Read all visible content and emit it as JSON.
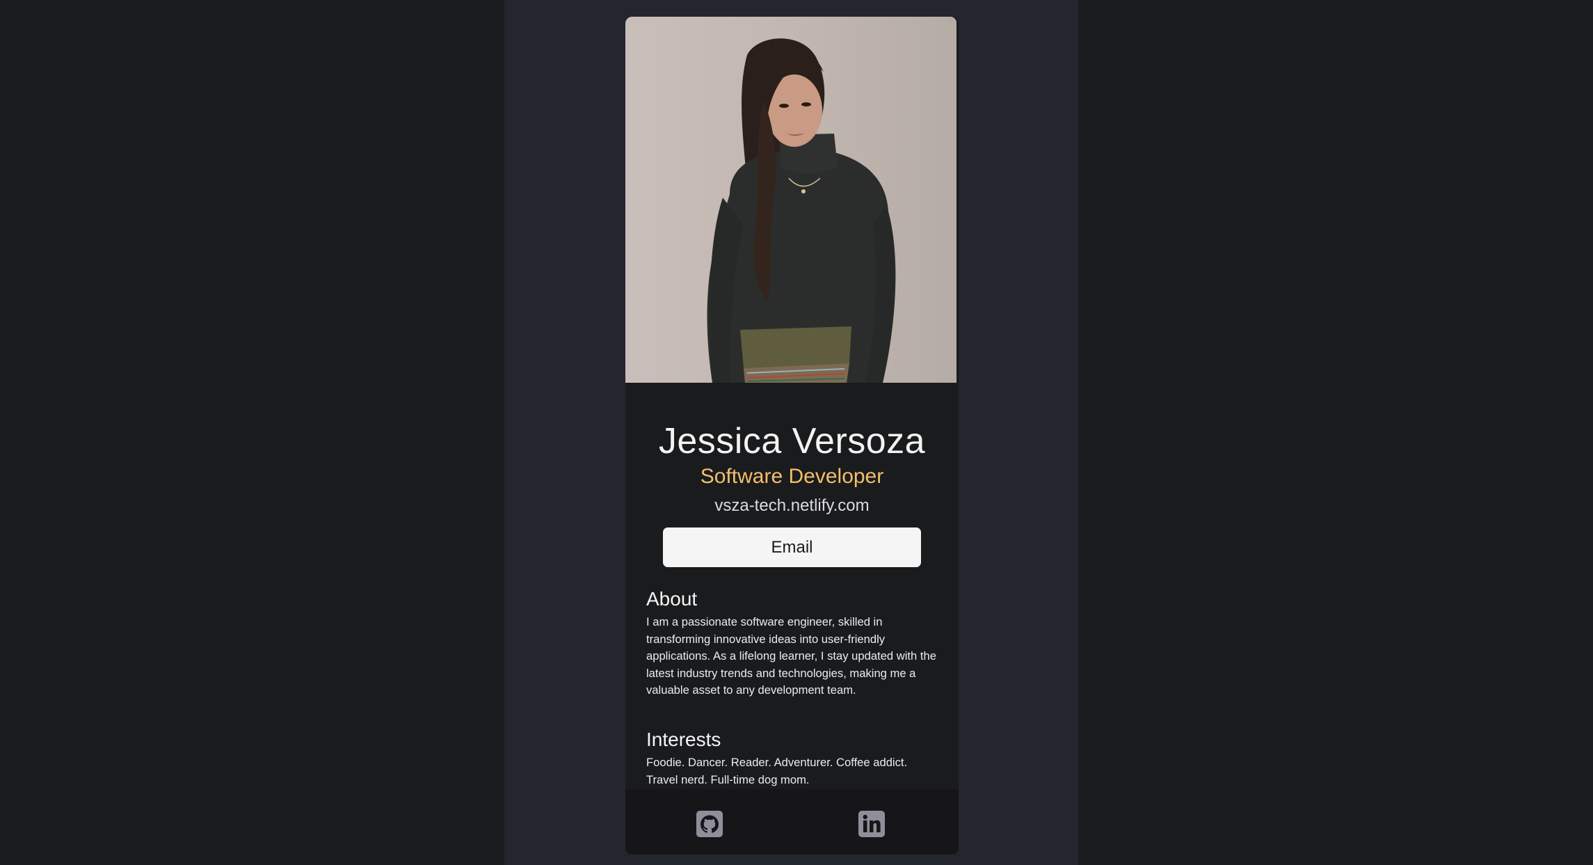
{
  "profile": {
    "photo_alt": "Portrait of Jessica Versoza",
    "name": "Jessica Versoza",
    "role": "Software Developer",
    "website": "vsza-tech.netlify.com",
    "email_label": "Email"
  },
  "about": {
    "heading": "About",
    "text": "I am a passionate software engineer, skilled in transforming innovative ideas into user-friendly applications. As a lifelong learner, I stay updated with the latest industry trends and technologies, making me a valuable asset to any development team."
  },
  "interests": {
    "heading": "Interests",
    "text": "Foodie. Dancer. Reader. Adventurer. Coffee addict. Travel nerd. Full-time dog mom."
  },
  "footer": {
    "icons": [
      "github-icon",
      "linkedin-icon"
    ]
  },
  "colors": {
    "page_background": "#1a1b1e",
    "column_background": "#23252f",
    "card_background": "#1a1b1d",
    "accent": "#f3bf6b",
    "footer_background": "#161619",
    "icon": "#918e9b"
  }
}
